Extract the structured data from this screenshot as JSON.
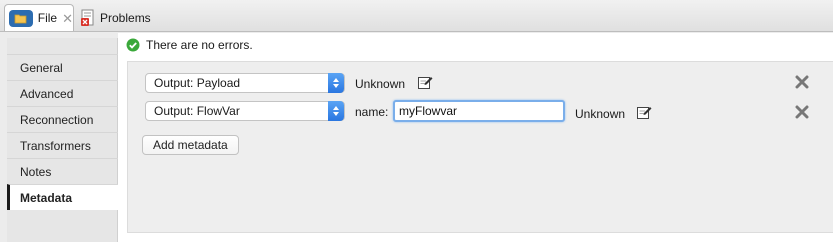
{
  "tabs": [
    {
      "label": "File",
      "icon": "folder-icon",
      "active": true
    },
    {
      "label": "Problems",
      "icon": "problems-icon",
      "active": false
    }
  ],
  "sidebar": {
    "items": [
      {
        "label": "General"
      },
      {
        "label": "Advanced"
      },
      {
        "label": "Reconnection"
      },
      {
        "label": "Transformers"
      },
      {
        "label": "Notes"
      },
      {
        "label": "Metadata",
        "active": true
      }
    ]
  },
  "status": {
    "text": "There are no errors.",
    "icon": "check-circle-icon",
    "color": "#3aa83a"
  },
  "metadata": {
    "rows": [
      {
        "select_value": "Output: Payload",
        "type_label": "Unknown"
      },
      {
        "select_value": "Output: FlowVar",
        "name_label": "name:",
        "name_value": "myFlowvar",
        "type_label": "Unknown"
      }
    ],
    "add_button": "Add metadata"
  },
  "colors": {
    "accent": "#2a76e0",
    "focus": "#7aaeea"
  }
}
